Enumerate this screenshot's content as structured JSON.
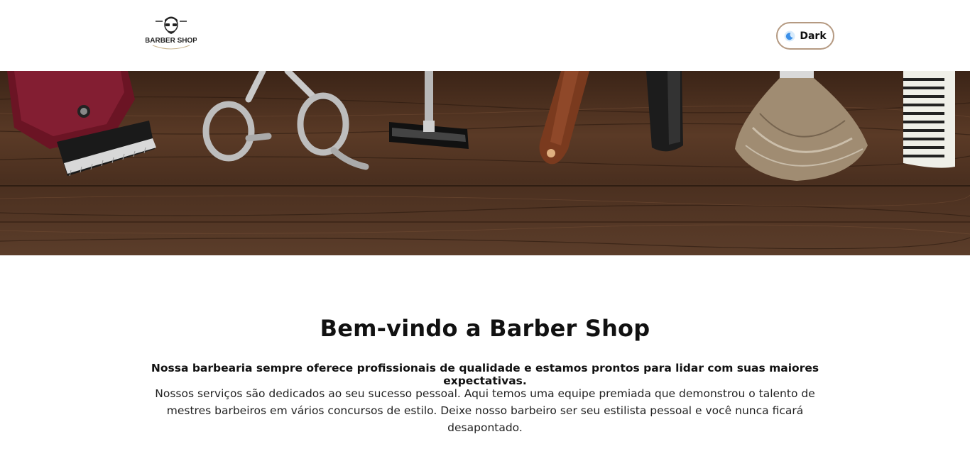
{
  "header": {
    "logo_text": "BARBER SHOP",
    "theme_toggle_label": "Dark"
  },
  "hero": {
    "icons": [
      "hair-clipper-icon",
      "scissors-icon",
      "razor-icon",
      "straight-razor-icon",
      "shaving-brush-icon",
      "comb-icon"
    ]
  },
  "main": {
    "title": "Bem-vindo a Barber Shop",
    "lead": "Nossa barbearia sempre oferece profissionais de qualidade e estamos prontos para lidar com suas maiores expectativas.",
    "description": "Nossos serviços são dedicados ao seu sucesso pessoal. Aqui temos uma equipe premiada que demonstrou o talento de mestres barbeiros em vários concursos de estilo. Deixe nosso barbeiro ser seu estilista pessoal e você nunca ficará desapontado."
  },
  "colors": {
    "wood": "#4a2f1f",
    "toggle_border": "#b59a82",
    "moon": "#3b8fe8"
  }
}
